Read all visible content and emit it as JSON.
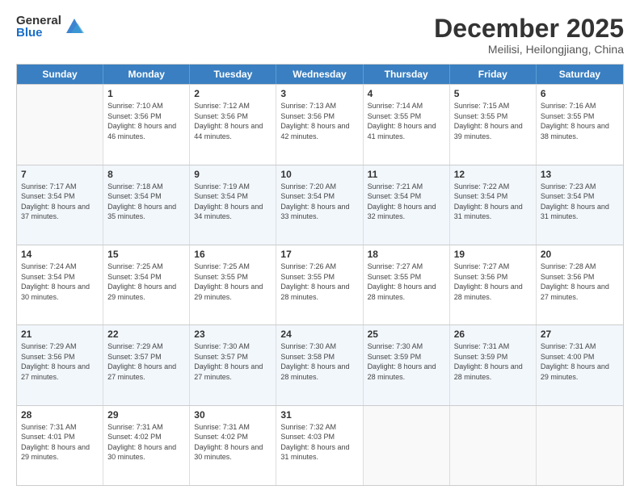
{
  "logo": {
    "general": "General",
    "blue": "Blue"
  },
  "title": "December 2025",
  "subtitle": "Meilisi, Heilongjiang, China",
  "header_days": [
    "Sunday",
    "Monday",
    "Tuesday",
    "Wednesday",
    "Thursday",
    "Friday",
    "Saturday"
  ],
  "weeks": [
    [
      {
        "day": "",
        "sunrise": "",
        "sunset": "",
        "daylight": ""
      },
      {
        "day": "1",
        "sunrise": "Sunrise: 7:10 AM",
        "sunset": "Sunset: 3:56 PM",
        "daylight": "Daylight: 8 hours and 46 minutes."
      },
      {
        "day": "2",
        "sunrise": "Sunrise: 7:12 AM",
        "sunset": "Sunset: 3:56 PM",
        "daylight": "Daylight: 8 hours and 44 minutes."
      },
      {
        "day": "3",
        "sunrise": "Sunrise: 7:13 AM",
        "sunset": "Sunset: 3:56 PM",
        "daylight": "Daylight: 8 hours and 42 minutes."
      },
      {
        "day": "4",
        "sunrise": "Sunrise: 7:14 AM",
        "sunset": "Sunset: 3:55 PM",
        "daylight": "Daylight: 8 hours and 41 minutes."
      },
      {
        "day": "5",
        "sunrise": "Sunrise: 7:15 AM",
        "sunset": "Sunset: 3:55 PM",
        "daylight": "Daylight: 8 hours and 39 minutes."
      },
      {
        "day": "6",
        "sunrise": "Sunrise: 7:16 AM",
        "sunset": "Sunset: 3:55 PM",
        "daylight": "Daylight: 8 hours and 38 minutes."
      }
    ],
    [
      {
        "day": "7",
        "sunrise": "Sunrise: 7:17 AM",
        "sunset": "Sunset: 3:54 PM",
        "daylight": "Daylight: 8 hours and 37 minutes."
      },
      {
        "day": "8",
        "sunrise": "Sunrise: 7:18 AM",
        "sunset": "Sunset: 3:54 PM",
        "daylight": "Daylight: 8 hours and 35 minutes."
      },
      {
        "day": "9",
        "sunrise": "Sunrise: 7:19 AM",
        "sunset": "Sunset: 3:54 PM",
        "daylight": "Daylight: 8 hours and 34 minutes."
      },
      {
        "day": "10",
        "sunrise": "Sunrise: 7:20 AM",
        "sunset": "Sunset: 3:54 PM",
        "daylight": "Daylight: 8 hours and 33 minutes."
      },
      {
        "day": "11",
        "sunrise": "Sunrise: 7:21 AM",
        "sunset": "Sunset: 3:54 PM",
        "daylight": "Daylight: 8 hours and 32 minutes."
      },
      {
        "day": "12",
        "sunrise": "Sunrise: 7:22 AM",
        "sunset": "Sunset: 3:54 PM",
        "daylight": "Daylight: 8 hours and 31 minutes."
      },
      {
        "day": "13",
        "sunrise": "Sunrise: 7:23 AM",
        "sunset": "Sunset: 3:54 PM",
        "daylight": "Daylight: 8 hours and 31 minutes."
      }
    ],
    [
      {
        "day": "14",
        "sunrise": "Sunrise: 7:24 AM",
        "sunset": "Sunset: 3:54 PM",
        "daylight": "Daylight: 8 hours and 30 minutes."
      },
      {
        "day": "15",
        "sunrise": "Sunrise: 7:25 AM",
        "sunset": "Sunset: 3:54 PM",
        "daylight": "Daylight: 8 hours and 29 minutes."
      },
      {
        "day": "16",
        "sunrise": "Sunrise: 7:25 AM",
        "sunset": "Sunset: 3:55 PM",
        "daylight": "Daylight: 8 hours and 29 minutes."
      },
      {
        "day": "17",
        "sunrise": "Sunrise: 7:26 AM",
        "sunset": "Sunset: 3:55 PM",
        "daylight": "Daylight: 8 hours and 28 minutes."
      },
      {
        "day": "18",
        "sunrise": "Sunrise: 7:27 AM",
        "sunset": "Sunset: 3:55 PM",
        "daylight": "Daylight: 8 hours and 28 minutes."
      },
      {
        "day": "19",
        "sunrise": "Sunrise: 7:27 AM",
        "sunset": "Sunset: 3:56 PM",
        "daylight": "Daylight: 8 hours and 28 minutes."
      },
      {
        "day": "20",
        "sunrise": "Sunrise: 7:28 AM",
        "sunset": "Sunset: 3:56 PM",
        "daylight": "Daylight: 8 hours and 27 minutes."
      }
    ],
    [
      {
        "day": "21",
        "sunrise": "Sunrise: 7:29 AM",
        "sunset": "Sunset: 3:56 PM",
        "daylight": "Daylight: 8 hours and 27 minutes."
      },
      {
        "day": "22",
        "sunrise": "Sunrise: 7:29 AM",
        "sunset": "Sunset: 3:57 PM",
        "daylight": "Daylight: 8 hours and 27 minutes."
      },
      {
        "day": "23",
        "sunrise": "Sunrise: 7:30 AM",
        "sunset": "Sunset: 3:57 PM",
        "daylight": "Daylight: 8 hours and 27 minutes."
      },
      {
        "day": "24",
        "sunrise": "Sunrise: 7:30 AM",
        "sunset": "Sunset: 3:58 PM",
        "daylight": "Daylight: 8 hours and 28 minutes."
      },
      {
        "day": "25",
        "sunrise": "Sunrise: 7:30 AM",
        "sunset": "Sunset: 3:59 PM",
        "daylight": "Daylight: 8 hours and 28 minutes."
      },
      {
        "day": "26",
        "sunrise": "Sunrise: 7:31 AM",
        "sunset": "Sunset: 3:59 PM",
        "daylight": "Daylight: 8 hours and 28 minutes."
      },
      {
        "day": "27",
        "sunrise": "Sunrise: 7:31 AM",
        "sunset": "Sunset: 4:00 PM",
        "daylight": "Daylight: 8 hours and 29 minutes."
      }
    ],
    [
      {
        "day": "28",
        "sunrise": "Sunrise: 7:31 AM",
        "sunset": "Sunset: 4:01 PM",
        "daylight": "Daylight: 8 hours and 29 minutes."
      },
      {
        "day": "29",
        "sunrise": "Sunrise: 7:31 AM",
        "sunset": "Sunset: 4:02 PM",
        "daylight": "Daylight: 8 hours and 30 minutes."
      },
      {
        "day": "30",
        "sunrise": "Sunrise: 7:31 AM",
        "sunset": "Sunset: 4:02 PM",
        "daylight": "Daylight: 8 hours and 30 minutes."
      },
      {
        "day": "31",
        "sunrise": "Sunrise: 7:32 AM",
        "sunset": "Sunset: 4:03 PM",
        "daylight": "Daylight: 8 hours and 31 minutes."
      },
      {
        "day": "",
        "sunrise": "",
        "sunset": "",
        "daylight": ""
      },
      {
        "day": "",
        "sunrise": "",
        "sunset": "",
        "daylight": ""
      },
      {
        "day": "",
        "sunrise": "",
        "sunset": "",
        "daylight": ""
      }
    ]
  ]
}
